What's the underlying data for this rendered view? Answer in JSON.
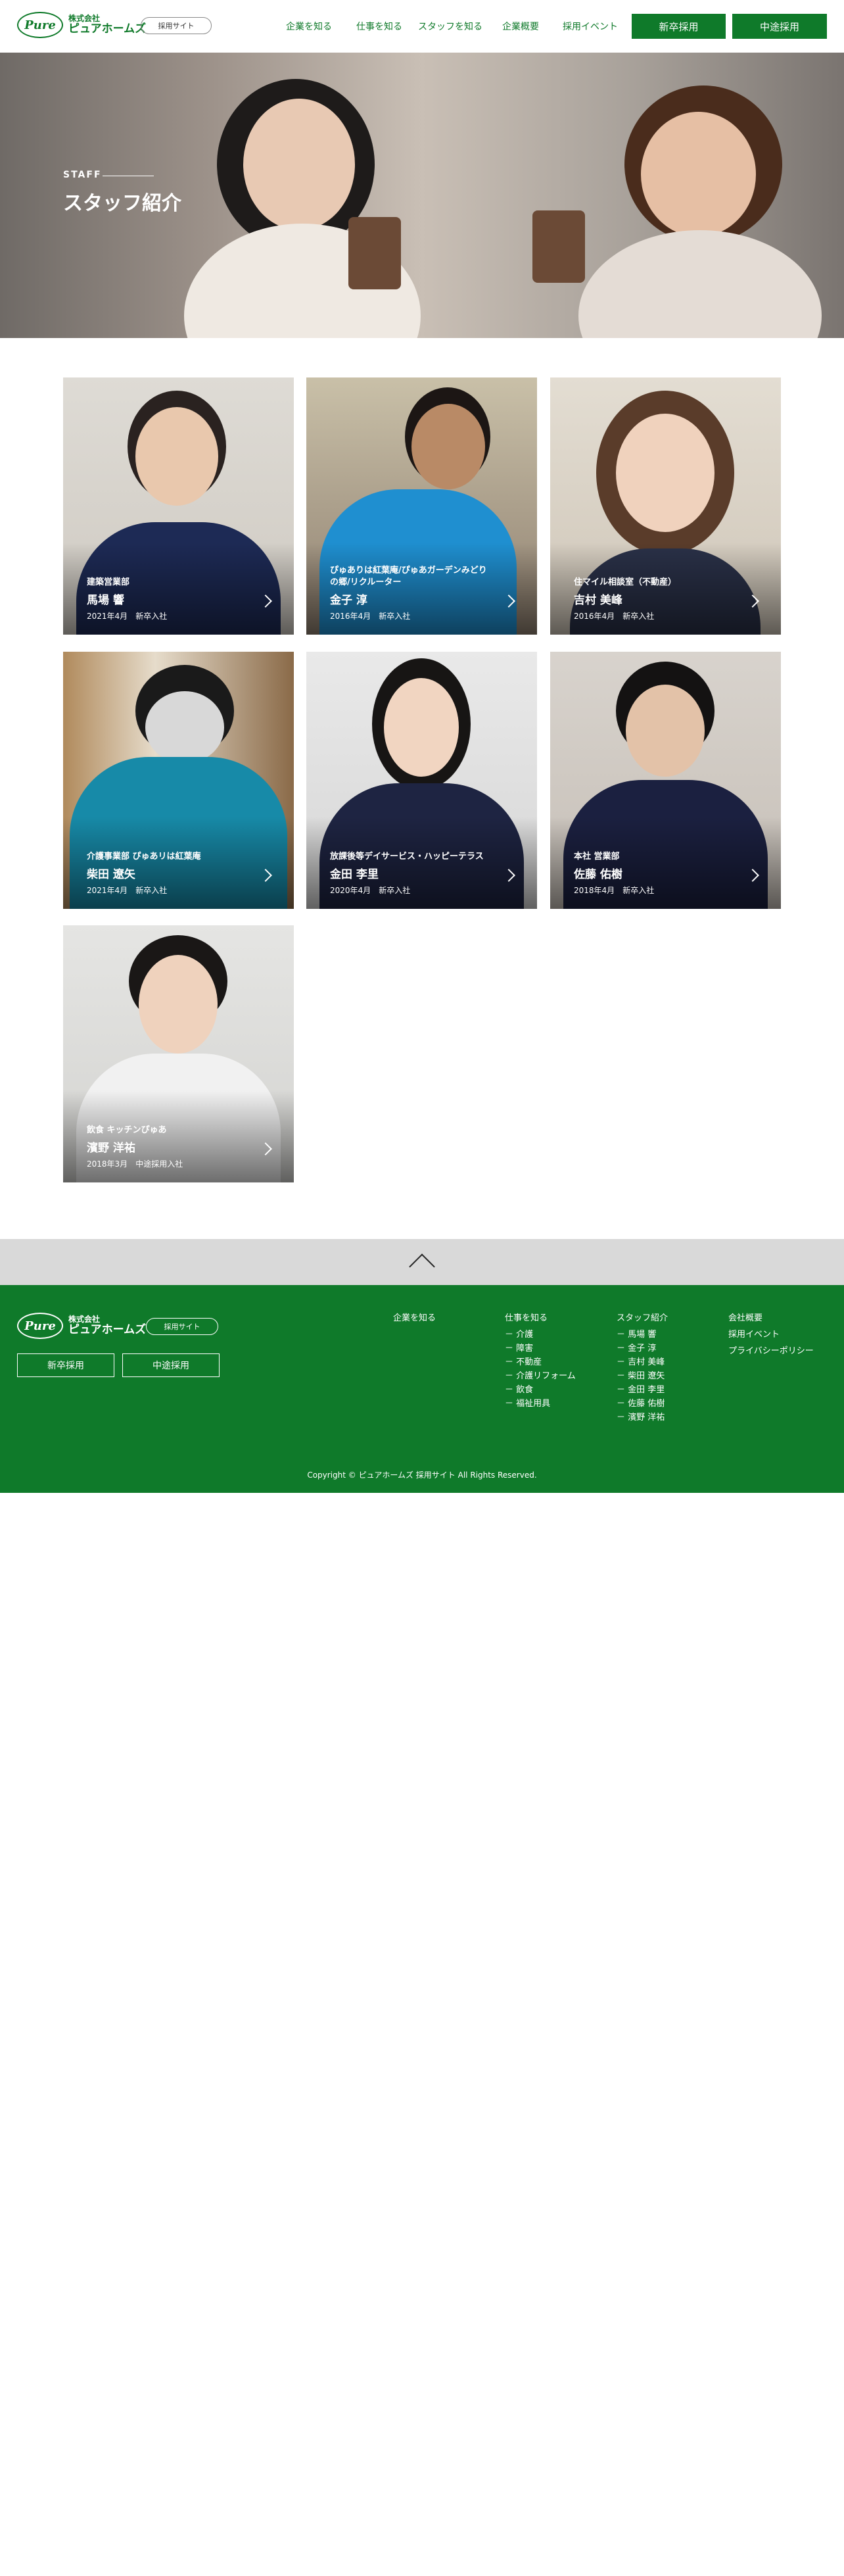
{
  "header": {
    "logo_mark": "Pure",
    "logo_line1": "株式会社",
    "logo_line2": "ピュアホームズ",
    "site_badge": "採用サイト",
    "nav": [
      "企業を知る",
      "仕事を知る",
      "スタッフを知る",
      "企業概要",
      "採用イベント"
    ],
    "new_grad_button": "新卒採用",
    "mid_career_button": "中途採用",
    "accent_color": "#0f7a2a"
  },
  "hero": {
    "label": "STAFF",
    "title": "スタッフ紹介"
  },
  "staff": [
    {
      "dept": "建築営業部",
      "name": "馬場 響",
      "joined": "2021年4月",
      "type": "新卒入社"
    },
    {
      "dept": "ぴゅありは紅葉庵/ぴゅあガーデンみどりの郷/リクルーター",
      "name": "金子 淳",
      "joined": "2016年4月",
      "type": "新卒入社"
    },
    {
      "dept": "住マイル相談室（不動産）",
      "name": "吉村 美峰",
      "joined": "2016年4月",
      "type": "新卒入社"
    },
    {
      "dept": "介護事業部 ぴゅあリは紅葉庵",
      "name": "柴田 遼矢",
      "joined": "2021年4月",
      "type": "新卒入社"
    },
    {
      "dept": "放課後等デイサービス・ハッピーテラス",
      "name": "金田 李里",
      "joined": "2020年4月",
      "type": "新卒入社"
    },
    {
      "dept": "本社 営業部",
      "name": "佐藤 佑樹",
      "joined": "2018年4月",
      "type": "新卒入社"
    },
    {
      "dept": "飲食 キッチンぴゅあ",
      "name": "濱野 洋祐",
      "joined": "2018年3月",
      "type": "中途採用入社"
    }
  ],
  "footer": {
    "logo_mark": "Pure",
    "logo_line1": "株式会社",
    "logo_line2": "ピュアホームズ",
    "site_badge": "採用サイト",
    "new_grad_button": "新卒採用",
    "mid_career_button": "中途採用",
    "col1_head": "企業を知る",
    "col2_head": "仕事を知る",
    "col2_items": [
      "介護",
      "障害",
      "不動産",
      "介護リフォーム",
      "飲食",
      "福祉用具"
    ],
    "col3_head": "スタッフ紹介",
    "col3_items": [
      "馬場 響",
      "金子 淳",
      "吉村 美峰",
      "柴田 遼矢",
      "金田 李里",
      "佐藤 佑樹",
      "濱野 洋祐"
    ],
    "col4_items": [
      "会社概要",
      "採用イベント",
      "プライバシーポリシー"
    ],
    "dash": "－",
    "copyright": "Copyright © ピュアホームズ 採用サイト All Rights Reserved."
  }
}
